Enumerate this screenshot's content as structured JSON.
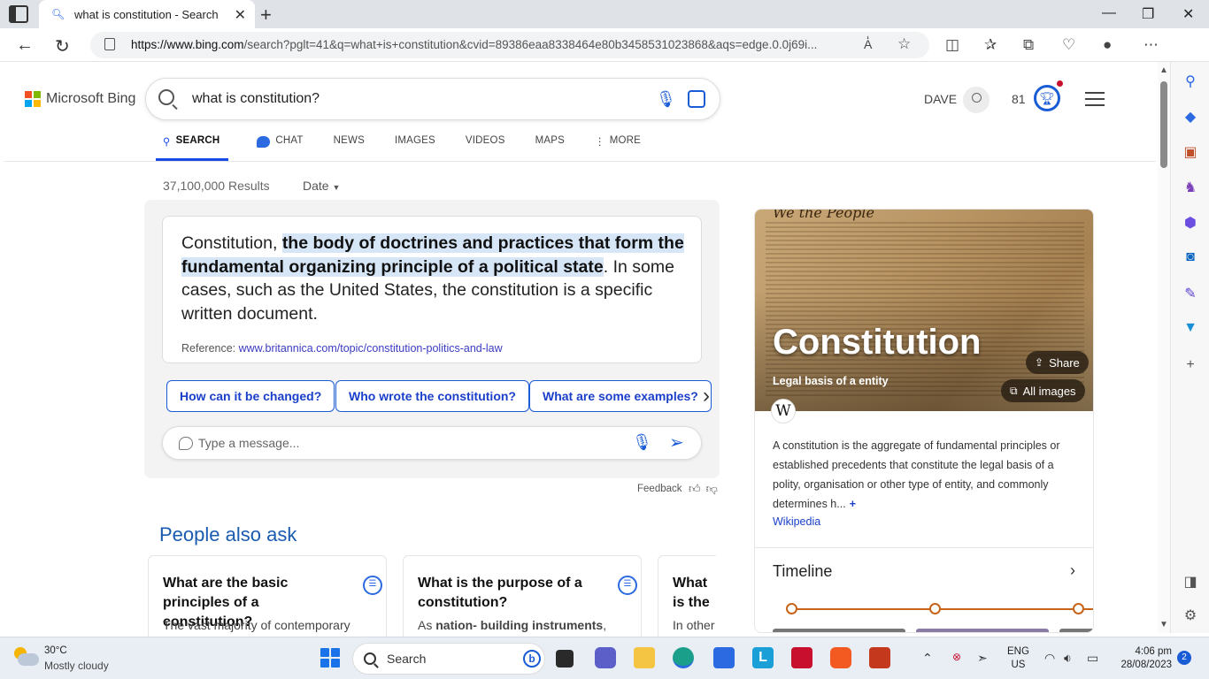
{
  "browser": {
    "tab_title": "what is constitution - Search",
    "url_domain": "https://www.bing.com",
    "url_rest": "/search?pglt=41&q=what+is+constitution&cvid=89386eaa8338464e80b3458531023868&aqs=edge.0.0j69i...",
    "read_aloud_label": "A̒"
  },
  "bing": {
    "brand": "Microsoft Bing",
    "query": "what is constitution?",
    "user_name": "DAVE",
    "points": "81",
    "scopes": [
      "SEARCH",
      "CHAT",
      "NEWS",
      "IMAGES",
      "VIDEOS",
      "MAPS",
      "MORE"
    ],
    "results_count": "37,100,000 Results",
    "date_filter": "Date"
  },
  "answer": {
    "lead": "Constitution, ",
    "highlight": "the body of doctrines and practices that form the fundamental organizing principle of a political state",
    "rest": ". In some cases, such as the United States, the constitution is a specific written document.",
    "ref_label": "Reference: ",
    "ref_link": "www.britannica.com/topic/constitution-politics-and-law",
    "chips": [
      "How can it be changed?",
      "Who wrote the constitution?",
      "What are some examples?"
    ],
    "message_placeholder": "Type a message...",
    "feedback": "Feedback"
  },
  "paa": {
    "title": "People also ask",
    "items": [
      {
        "q": "What are the basic principles of a constitution?",
        "a": "The vast majority of contemporary"
      },
      {
        "q": "What is the purpose of a constitution?",
        "a_bold": "nation- building instruments",
        "a_pre": "As ",
        "a_post": ","
      },
      {
        "q": "What is the constit",
        "a": "In other"
      }
    ]
  },
  "kp": {
    "script_text": "We the People",
    "title": "Constitution",
    "subtitle": "Legal basis of a entity",
    "share": "Share",
    "all_images": "All images",
    "wiki_glyph": "W",
    "description": "A constitution is the aggregate of fundamental principles or established precedents that constitute the legal basis of a polity, organisation or other type of entity, and commonly determines h...",
    "more": "+",
    "source": "Wikipedia",
    "timeline_title": "Timeline"
  },
  "taskbar": {
    "temp": "30°C",
    "weather": "Mostly cloudy",
    "search_label": "Search",
    "lang_1": "ENG",
    "lang_2": "US",
    "time": "4:06 pm",
    "date": "28/08/2023",
    "notif_count": "2"
  },
  "colors": {
    "accent": "#174ae4",
    "link": "#1a3fc9",
    "highlight": "#d6e6f7",
    "timeline": "#c8641a"
  }
}
